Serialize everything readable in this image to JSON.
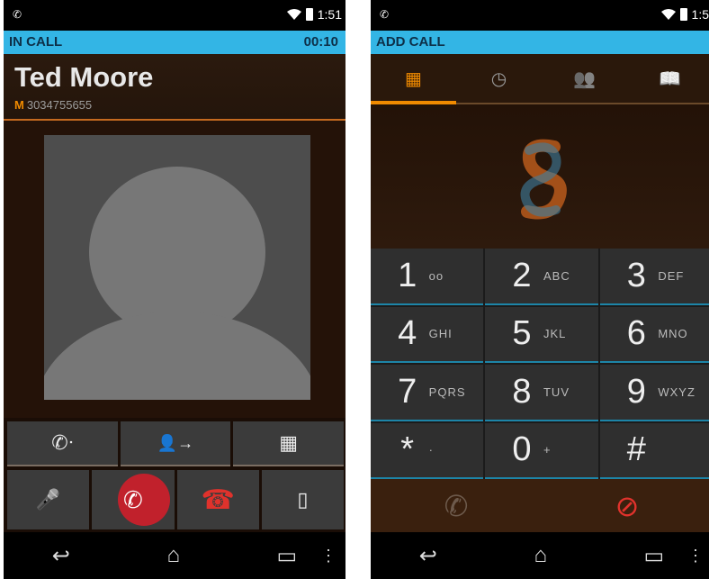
{
  "left": {
    "status": {
      "notify_glyph": "✆",
      "time": "1:51"
    },
    "call_bar": {
      "state": "IN CALL",
      "timer": "00:10"
    },
    "caller": {
      "name": "Ted Moore",
      "phone_type": "M",
      "number": "3034755655"
    },
    "controls_row1": [
      {
        "icon": "hold-icon",
        "glyph": "✆ᐧ"
      },
      {
        "icon": "add-call-icon",
        "glyph": "👤→"
      },
      {
        "icon": "dialpad-icon",
        "glyph": "▦"
      }
    ],
    "controls_row2": [
      {
        "icon": "mute-icon",
        "glyph": "🎤"
      },
      {
        "icon": "record-icon",
        "glyph": "✆"
      },
      {
        "icon": "end-call-icon",
        "glyph": "☎"
      },
      {
        "icon": "speaker-icon",
        "glyph": "▯"
      }
    ]
  },
  "right": {
    "status": {
      "notify_glyph": "✆",
      "time": "1:5"
    },
    "call_bar": {
      "state": "ADD CALL"
    },
    "tabs": [
      {
        "icon": "dialpad-tab-icon",
        "glyph": "▦"
      },
      {
        "icon": "recent-tab-icon",
        "glyph": "◷"
      },
      {
        "icon": "contacts-tab-icon",
        "glyph": "👥"
      },
      {
        "icon": "favorites-tab-icon",
        "glyph": "📖"
      }
    ],
    "keys": [
      {
        "digit": "1",
        "letters": "oo"
      },
      {
        "digit": "2",
        "letters": "ABC"
      },
      {
        "digit": "3",
        "letters": "DEF"
      },
      {
        "digit": "4",
        "letters": "GHI"
      },
      {
        "digit": "5",
        "letters": "JKL"
      },
      {
        "digit": "6",
        "letters": "MNO"
      },
      {
        "digit": "7",
        "letters": "PQRS"
      },
      {
        "digit": "8",
        "letters": "TUV"
      },
      {
        "digit": "9",
        "letters": "WXYZ"
      },
      {
        "digit": "*",
        "letters": "·"
      },
      {
        "digit": "0",
        "letters": "+"
      },
      {
        "digit": "#",
        "letters": ""
      }
    ],
    "actions": {
      "call_glyph": "✆",
      "cancel_glyph": "⊘"
    }
  },
  "navbar": {
    "back": "↩",
    "home": "⌂",
    "recents": "▭",
    "more": "⋮"
  },
  "colors": {
    "accent_blue": "#33b5e5",
    "accent_orange": "#f08a00",
    "end_red": "#e0322c"
  }
}
